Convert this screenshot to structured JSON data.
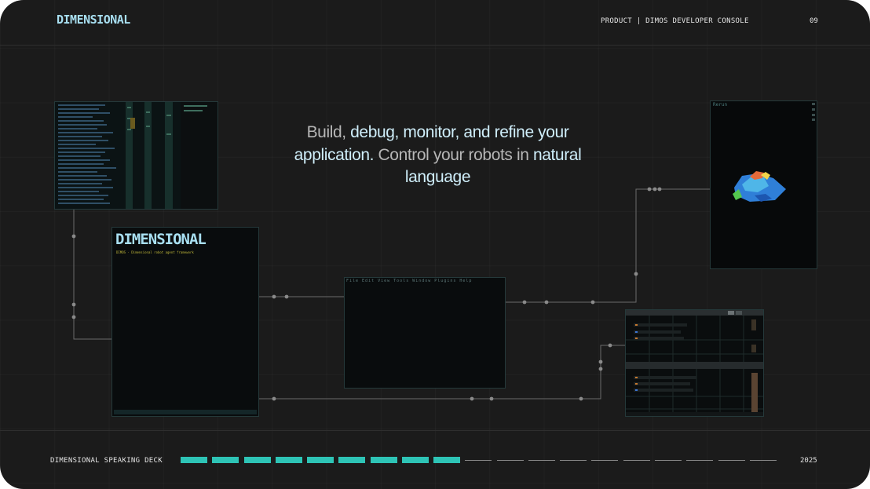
{
  "header": {
    "logo": "DIMENSIONAL",
    "product": "PRODUCT | DIMOS DEVELOPER CONSOLE",
    "page_number": "09"
  },
  "headline": {
    "part1": "Build, ",
    "part2": "debug, monitor, and refine your application.",
    "part3": "  Control your robots in ",
    "part4": "natural language"
  },
  "terminal": {
    "logo": "DIMENSIONAL",
    "subtitle": "DIMOS · Dimensional robot agent framework"
  },
  "editor": {
    "menu": "File Edit View Tools Window Plugins Help"
  },
  "viewer": {
    "tag": "Rerun"
  },
  "footer": {
    "deck_label": "DIMENSIONAL SPEAKING DECK",
    "year": "2025",
    "progress": {
      "current": 9,
      "total": 19
    }
  },
  "colors": {
    "accent": "#2ec4b6",
    "highlight": "#cfeefa",
    "logo": "#a8dff1",
    "background": "#1b1b1b"
  }
}
